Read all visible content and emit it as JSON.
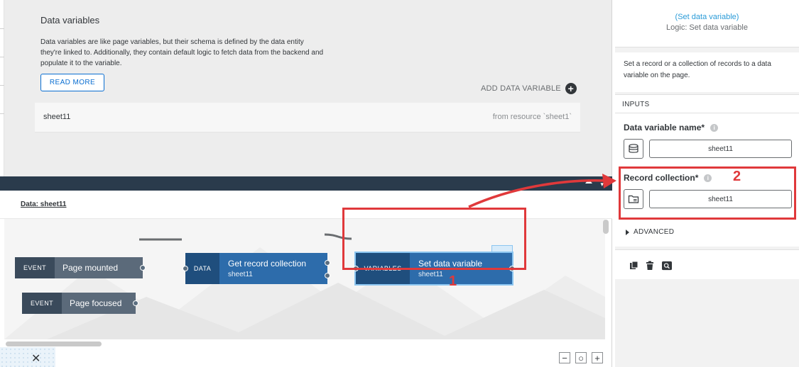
{
  "data_variables": {
    "title": "Data variables",
    "description": "Data variables are like page variables, but their schema is defined by the data entity they're linked to. Additionally, they contain default logic to fetch data from the backend and populate it to the variable.",
    "read_more_label": "READ MORE",
    "add_label": "ADD DATA VARIABLE",
    "items": [
      {
        "name": "sheet11",
        "source": "from resource `sheet1`"
      }
    ]
  },
  "logic_canvas": {
    "title": "Data: sheet11",
    "nodes": {
      "page_mounted": {
        "kind": "EVENT",
        "label": "Page mounted"
      },
      "page_focused": {
        "kind": "EVENT",
        "label": "Page focused"
      },
      "get_record": {
        "kind": "DATA",
        "label": "Get record collection",
        "sub": "sheet11"
      },
      "set_variable": {
        "kind": "VARIABLES",
        "label": "Set data variable",
        "sub": "sheet11"
      }
    },
    "zoom": {
      "out": "−",
      "reset": "○",
      "in": "+"
    },
    "close_glyph": "✕"
  },
  "properties": {
    "link": "(Set data variable)",
    "subtitle": "Logic: Set data variable",
    "description": "Set a record or a collection of records to a data variable on the page.",
    "inputs_heading": "INPUTS",
    "fields": [
      {
        "label": "Data variable name*",
        "value": "sheet11",
        "icon": "database-icon"
      },
      {
        "label": "Record collection*",
        "value": "sheet11",
        "icon": "folder-list-icon"
      }
    ],
    "advanced_label": "ADVANCED",
    "info_glyph": "i"
  },
  "annotations": {
    "label_1": "1",
    "label_2": "2"
  },
  "colors": {
    "accent": "#0a6ed1",
    "annotation": "#e0393b",
    "node_data": "#2d6cab",
    "node_event": "#5b6a7a",
    "divider_bar": "#2a3b4c"
  }
}
